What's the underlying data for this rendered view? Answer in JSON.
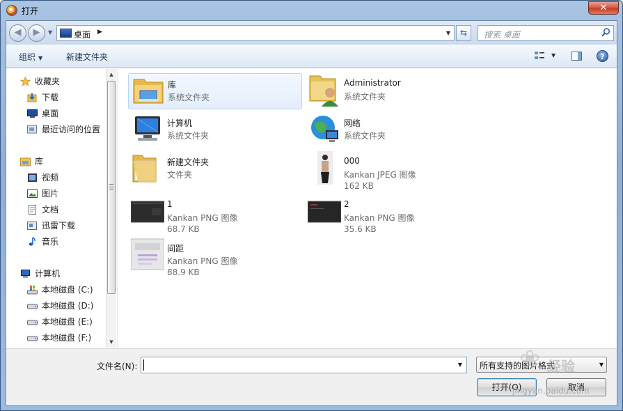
{
  "window": {
    "title": "打开",
    "close_glyph": "✕"
  },
  "address": {
    "path": "桌面",
    "path_arrow": "▶",
    "search_placeholder": "搜索 桌面"
  },
  "toolbar": {
    "organize": "组织",
    "new_folder": "新建文件夹"
  },
  "nav": {
    "favorites": {
      "label": "收藏夹",
      "items": [
        "下载",
        "桌面",
        "最近访问的位置"
      ]
    },
    "libraries": {
      "label": "库",
      "items": [
        "视频",
        "图片",
        "文档",
        "迅雷下载",
        "音乐"
      ]
    },
    "computer": {
      "label": "计算机",
      "items": [
        "本地磁盘 (C:)",
        "本地磁盘 (D:)",
        "本地磁盘 (E:)",
        "本地磁盘 (F:)"
      ]
    }
  },
  "items": [
    {
      "name": "库",
      "type": "系统文件夹",
      "size": "",
      "icon": "library-icon"
    },
    {
      "name": "Administrator",
      "type": "系统文件夹",
      "size": "",
      "icon": "user-folder-icon"
    },
    {
      "name": "计算机",
      "type": "系统文件夹",
      "size": "",
      "icon": "computer-icon"
    },
    {
      "name": "网络",
      "type": "系统文件夹",
      "size": "",
      "icon": "network-icon"
    },
    {
      "name": "新建文件夹",
      "type": "文件夹",
      "size": "",
      "icon": "folder-icon"
    },
    {
      "name": "000",
      "type": "Kankan JPEG 图像",
      "size": "162 KB",
      "icon": "photo-thumbnail"
    },
    {
      "name": "1",
      "type": "Kankan PNG 图像",
      "size": "68.7 KB",
      "icon": "dark-thumbnail"
    },
    {
      "name": "2",
      "type": "Kankan PNG 图像",
      "size": "35.6 KB",
      "icon": "dark-thumbnail"
    },
    {
      "name": "间距",
      "type": "Kankan PNG 图像",
      "size": "88.9 KB",
      "icon": "light-thumbnail"
    }
  ],
  "bottom": {
    "filename_label": "文件名(N):",
    "filename_value": "",
    "filter": "所有支持的图片格式",
    "open": "打开(O)",
    "cancel": "取消"
  },
  "watermark": {
    "text": "经验",
    "url": "jingyan.baidu.com"
  },
  "colors": {
    "selection": "#e3eefb",
    "frame": "#8fb0d6",
    "link": "#1e395b"
  }
}
